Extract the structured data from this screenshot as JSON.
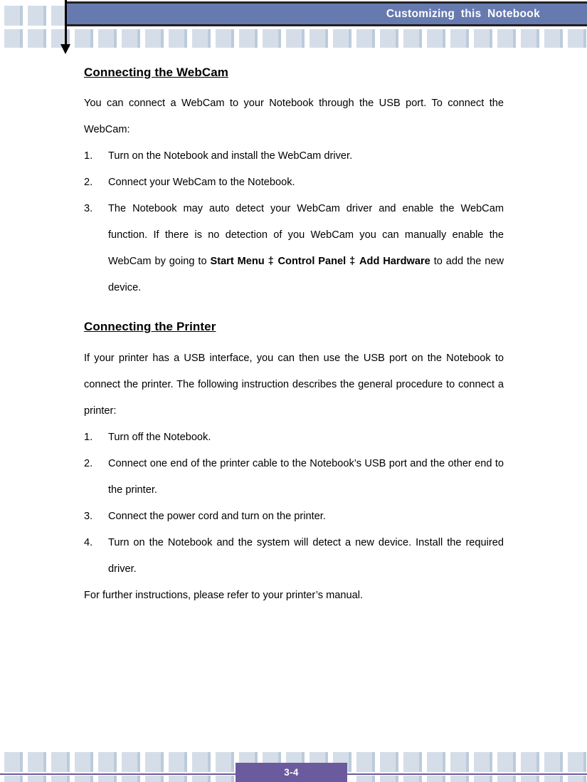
{
  "header": {
    "title": "Customizing  this  Notebook"
  },
  "sections": [
    {
      "heading": "Connecting the WebCam",
      "intro": "You can connect a WebCam to your Notebook through the USB port.   To connect the WebCam:",
      "steps": [
        {
          "num": "1.",
          "text": "Turn on the Notebook and install the WebCam driver."
        },
        {
          "num": "2.",
          "text": "Connect your WebCam to the Notebook."
        },
        {
          "num": "3.",
          "text_part1": "The Notebook may auto detect your WebCam driver and enable the WebCam function.   If there is no detection of you WebCam you can manually enable the WebCam by going to ",
          "bold1": "Start Menu ‡",
          "sep1": "  ",
          "bold2": "Control Panel ‡",
          "sep2": " ",
          "bold3": "Add Hardware",
          "text_part2": " to add the new device."
        }
      ]
    },
    {
      "heading": "Connecting the Printer",
      "intro": "If your printer has a USB interface, you can then use the USB port on the Notebook to connect the printer.   The following instruction describes the general procedure to connect a printer:",
      "steps": [
        {
          "num": "1.",
          "text": "Turn off the Notebook."
        },
        {
          "num": "2.",
          "text": "Connect one end of the printer cable to the Notebook’s USB port and the other end to the printer."
        },
        {
          "num": "3.",
          "text": "Connect the power cord and turn on the printer."
        },
        {
          "num": "4.",
          "text": "Turn on the Notebook and the system will detect a new device.   Install the required driver."
        }
      ],
      "closing": "For further instructions, please refer to your printer’s manual."
    }
  ],
  "footer": {
    "page_number": "3-4"
  },
  "colors": {
    "header_band": "#667ab0",
    "decoration_square": "#d5dee8",
    "footer_accent": "#6b5b9e"
  }
}
